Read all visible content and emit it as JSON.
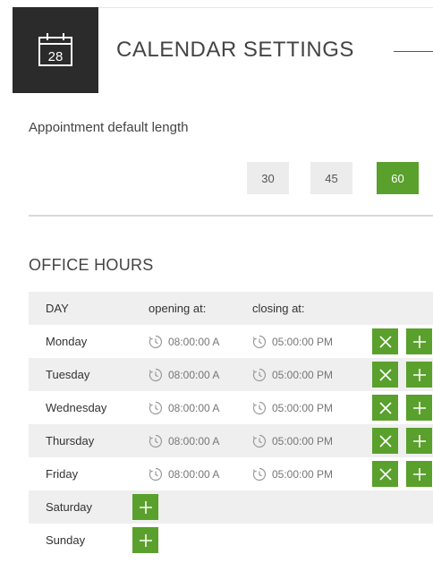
{
  "header": {
    "calendar_day": "28",
    "title": "CALENDAR SETTINGS"
  },
  "appointment": {
    "label": "Appointment default length",
    "options": [
      "30",
      "45",
      "60"
    ],
    "selected": "60"
  },
  "office_hours": {
    "title": "OFFICE HOURS",
    "columns": [
      "DAY",
      "opening at:",
      "closing at:"
    ],
    "days": [
      {
        "day": "Monday",
        "open": "08:00:00 A",
        "close": "05:00:00 PM",
        "has_hours": true
      },
      {
        "day": "Tuesday",
        "open": "08:00:00 A",
        "close": "05:00:00 PM",
        "has_hours": true
      },
      {
        "day": "Wednesday",
        "open": "08:00:00 A",
        "close": "05:00:00 PM",
        "has_hours": true
      },
      {
        "day": "Thursday",
        "open": "08:00:00 A",
        "close": "05:00:00 PM",
        "has_hours": true
      },
      {
        "day": "Friday",
        "open": "08:00:00 A",
        "close": "05:00:00 PM",
        "has_hours": true
      },
      {
        "day": "Saturday",
        "has_hours": false
      },
      {
        "day": "Sunday",
        "has_hours": false
      }
    ]
  },
  "colors": {
    "accent": "#5aa02c",
    "header_bg": "#2b2b2b",
    "row_shade": "#efefef"
  },
  "icons": {
    "header": "calendar-icon",
    "time": "clock-icon",
    "remove": "close-icon",
    "add": "plus-icon"
  }
}
